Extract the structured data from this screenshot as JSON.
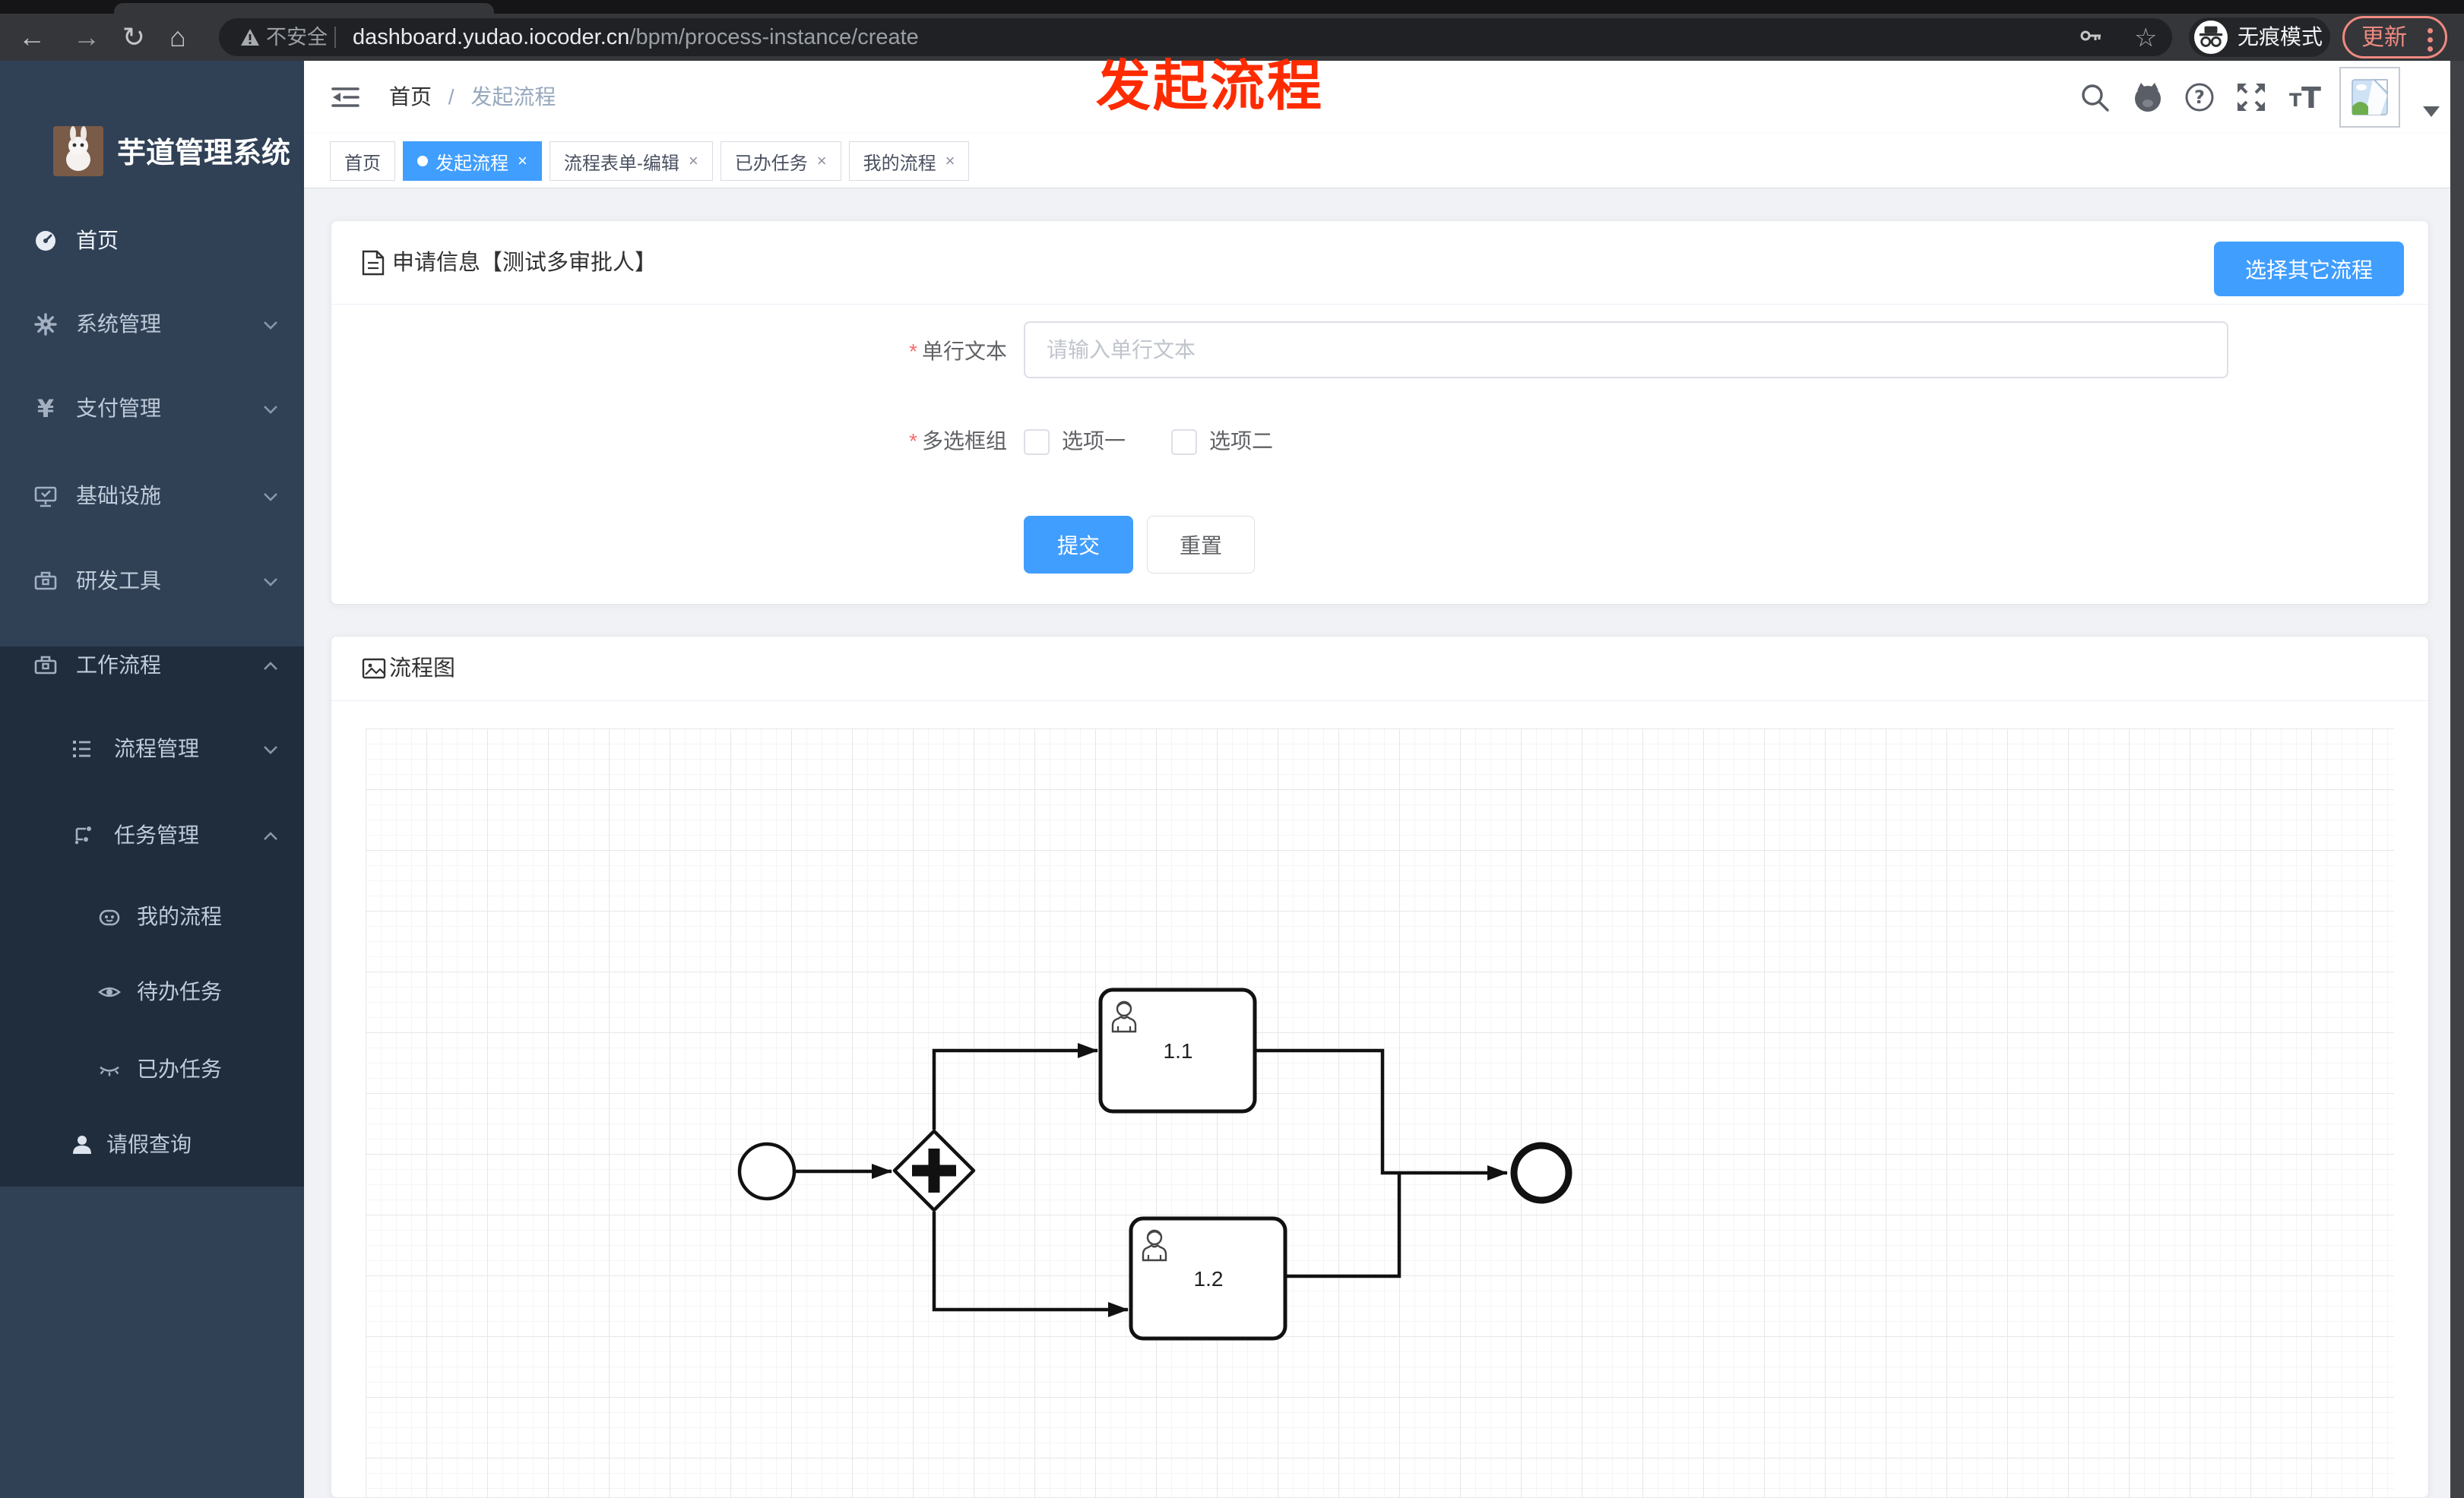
{
  "browser": {
    "security_label": "不安全",
    "url_host": "dashboard.yudao.iocoder.cn",
    "url_path": "/bpm/process-instance/create",
    "incognito_label": "无痕模式",
    "update_label": "更新"
  },
  "sidebar": {
    "title": "芋道管理系统",
    "items": [
      {
        "label": "首页",
        "icon": "dashboard-icon",
        "level": 1
      },
      {
        "label": "系统管理",
        "icon": "gear-icon",
        "level": 1,
        "arrow": "down"
      },
      {
        "label": "支付管理",
        "icon": "yen-icon",
        "level": 1,
        "arrow": "down"
      },
      {
        "label": "基础设施",
        "icon": "monitor-icon",
        "level": 1,
        "arrow": "down"
      },
      {
        "label": "研发工具",
        "icon": "toolbox-icon",
        "level": 1,
        "arrow": "down"
      },
      {
        "label": "工作流程",
        "icon": "toolbox-icon",
        "level": 1,
        "arrow": "up"
      },
      {
        "label": "流程管理",
        "icon": "tree-list-icon",
        "level": 2,
        "arrow": "down"
      },
      {
        "label": "任务管理",
        "icon": "flow-icon",
        "level": 2,
        "arrow": "up"
      },
      {
        "label": "我的流程",
        "icon": "face-icon",
        "level": 3
      },
      {
        "label": "待办任务",
        "icon": "eye-open-icon",
        "level": 3
      },
      {
        "label": "已办任务",
        "icon": "eye-closed-icon",
        "level": 3
      },
      {
        "label": "请假查询",
        "icon": "user-icon",
        "level": 2
      }
    ]
  },
  "navbar": {
    "breadcrumb": [
      "首页",
      "发起流程"
    ],
    "separator": "/"
  },
  "tabs": [
    {
      "label": "首页"
    },
    {
      "label": "发起流程",
      "active": true,
      "closable": true
    },
    {
      "label": "流程表单-编辑",
      "closable": true
    },
    {
      "label": "已办任务",
      "closable": true
    },
    {
      "label": "我的流程",
      "closable": true
    }
  ],
  "form_card": {
    "title": "申请信息【测试多审批人】",
    "action_button": "选择其它流程",
    "fields": [
      {
        "label": "单行文本",
        "required": true,
        "placeholder": "请输入单行文本",
        "value": ""
      },
      {
        "label": "多选框组",
        "required": true,
        "options": [
          {
            "label": "选项一",
            "checked": false
          },
          {
            "label": "选项二",
            "checked": false
          }
        ]
      }
    ],
    "submit_label": "提交",
    "reset_label": "重置"
  },
  "diagram_card": {
    "title": "流程图",
    "nodes": [
      {
        "id": "start",
        "type": "startEvent"
      },
      {
        "id": "gateway",
        "type": "parallelGateway"
      },
      {
        "id": "task1",
        "type": "userTask",
        "label": "1.1"
      },
      {
        "id": "task2",
        "type": "userTask",
        "label": "1.2"
      },
      {
        "id": "end",
        "type": "endEvent"
      }
    ],
    "flows": [
      "start->gateway",
      "gateway->task1",
      "gateway->task2",
      "task1->end",
      "task2->end"
    ]
  },
  "annotation": {
    "text": "发起流程"
  },
  "colors": {
    "accent": "#409eff",
    "sidebar_bg": "#304156",
    "submenu_bg": "#1f2d3d",
    "content_bg": "#f0f2f5",
    "chrome_bg": "#35363a",
    "annotation_red": "#fe2b00",
    "update_red": "#ef8a80"
  }
}
